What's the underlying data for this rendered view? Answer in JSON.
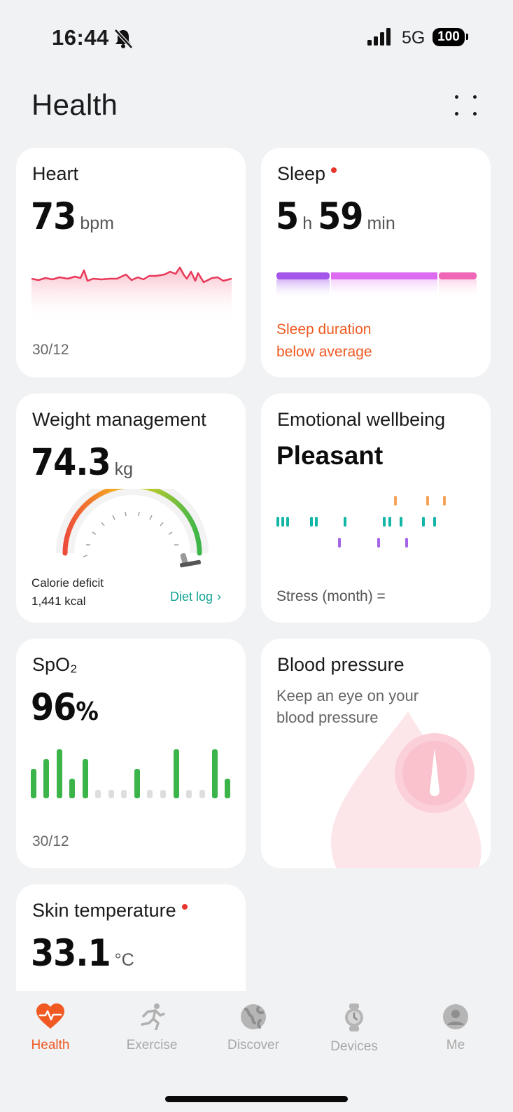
{
  "status": {
    "time": "16:44",
    "network": "5G",
    "battery": "100"
  },
  "header": {
    "title": "Health"
  },
  "heart": {
    "title": "Heart",
    "value": "73",
    "unit": "bpm",
    "date": "30/12"
  },
  "sleep": {
    "title": "Sleep",
    "hours": "5",
    "h_unit": "h",
    "minutes": "59",
    "m_unit": "min",
    "message_line1": "Sleep duration",
    "message_line2": "below average"
  },
  "weight": {
    "title": "Weight management",
    "value": "74.3",
    "unit": "kg",
    "deficit_label": "Calorie deficit",
    "deficit_value": "1,441 kcal",
    "diet_log": "Diet log"
  },
  "emotion": {
    "title": "Emotional wellbeing",
    "state": "Pleasant",
    "stress": "Stress (month) ="
  },
  "spo2": {
    "title": "SpO₂",
    "value": "96",
    "unit": "%",
    "date": "30/12"
  },
  "blood_pressure": {
    "title": "Blood pressure",
    "line1": "Keep an eye on your",
    "line2": "blood pressure"
  },
  "skin_temp": {
    "title": "Skin temperature",
    "value": "33.1",
    "unit": "°C"
  },
  "nav": [
    {
      "label": "Health",
      "icon": "heart-pulse-icon",
      "active": true
    },
    {
      "label": "Exercise",
      "icon": "running-icon",
      "active": false
    },
    {
      "label": "Discover",
      "icon": "globe-icon",
      "active": false
    },
    {
      "label": "Devices",
      "icon": "watch-icon",
      "active": false
    },
    {
      "label": "Me",
      "icon": "person-icon",
      "active": false
    }
  ],
  "colors": {
    "accent": "#f05a22",
    "heart_line": "#e8395a",
    "spo2_bar": "#3bb54a",
    "teal": "#12b6a6",
    "purple": "#a565e8",
    "orange": "#f4a35a"
  }
}
